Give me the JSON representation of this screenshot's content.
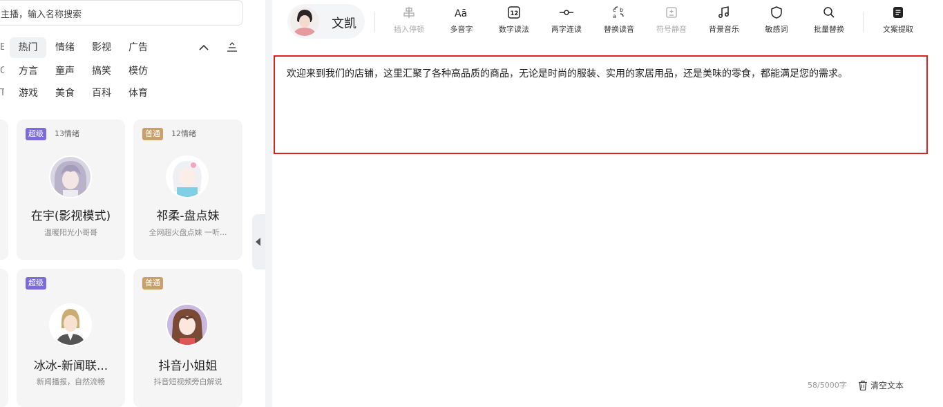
{
  "search": {
    "text": "主播，输入名称搜索"
  },
  "categories": {
    "row1": [
      "热门",
      "情绪",
      "影视",
      "广告"
    ],
    "row2": [
      "方言",
      "童声",
      "搞笑",
      "模仿"
    ],
    "row3": [
      "游戏",
      "美食",
      "百科",
      "体育"
    ],
    "edge": [
      "E",
      "C",
      "T"
    ]
  },
  "cards": [
    {
      "badge": "超级",
      "emotions": "13情绪",
      "name": "在宇(影视模式)",
      "desc": "温暖阳光小哥哥"
    },
    {
      "badge": "普通",
      "emotions": "12情绪",
      "name": "祁柔-盘点妹",
      "desc": "全网超火盘点妹 一听..."
    },
    {
      "badge": "超级",
      "emotions": "",
      "name": "冰冰-新闻联...",
      "desc": "新闻播报，自然流畅"
    },
    {
      "badge": "普通",
      "emotions": "",
      "name": "抖音小姐姐",
      "desc": "抖音短视频旁白解说"
    }
  ],
  "voice": {
    "name": "文凯"
  },
  "toolbar": [
    {
      "label": "插入停顿",
      "icon": "pause-insert-icon",
      "disabled": true
    },
    {
      "label": "多音字",
      "icon": "polyphone-icon",
      "disabled": false
    },
    {
      "label": "数字读法",
      "icon": "number-icon",
      "disabled": false
    },
    {
      "label": "两字连读",
      "icon": "link-read-icon",
      "disabled": false
    },
    {
      "label": "替换读音",
      "icon": "replace-sound-icon",
      "disabled": false
    },
    {
      "label": "符号静音",
      "icon": "symbol-mute-icon",
      "disabled": true
    },
    {
      "label": "背景音乐",
      "icon": "music-icon",
      "disabled": false
    },
    {
      "label": "敏感词",
      "icon": "shield-icon",
      "disabled": false
    },
    {
      "label": "批量替换",
      "icon": "search-icon",
      "disabled": false
    },
    {
      "label": "文案提取",
      "icon": "document-icon",
      "disabled": false
    }
  ],
  "editor": {
    "text": "欢迎来到我们的店铺，这里汇聚了各种高品质的商品，无论是时尚的服装、实用的家居用品，还是美味的零食，都能满足您的需求。"
  },
  "footer": {
    "counter": "58/5000字",
    "clear_label": "清空文本"
  },
  "colors": {
    "accent_red": "#e02020",
    "badge_super": "#7b6ad9",
    "badge_normal": "#c9a06a"
  }
}
